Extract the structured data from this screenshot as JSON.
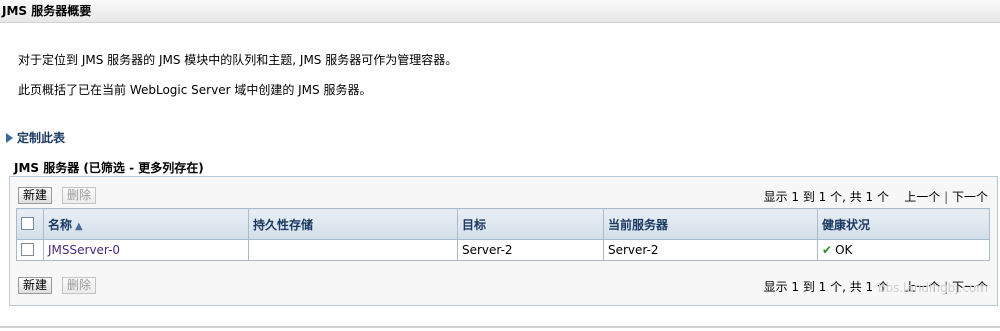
{
  "page": {
    "title": "JMS 服务器概要",
    "intro1": "对于定位到 JMS 服务器的 JMS 模块中的队列和主题, JMS 服务器可作为管理容器。",
    "intro2": "此页概括了已在当前 WebLogic Server 域中创建的 JMS 服务器。",
    "customize": "定制此表"
  },
  "table_section": {
    "title": "JMS 服务器 (已筛选 - 更多列存在)",
    "new_label": "新建",
    "delete_label": "删除",
    "pager": {
      "text": "显示 1 到 1 个, 共 1 个",
      "prev": "上一个",
      "next": "下一个"
    },
    "columns": [
      "名称",
      "持久性存储",
      "目标",
      "当前服务器",
      "健康状况"
    ],
    "rows": [
      {
        "name": "JMSServer-0",
        "store": "",
        "target": "Server-2",
        "current_server": "Server-2",
        "health": "OK"
      }
    ]
  },
  "watermark": "bbs.landingbj.com"
}
